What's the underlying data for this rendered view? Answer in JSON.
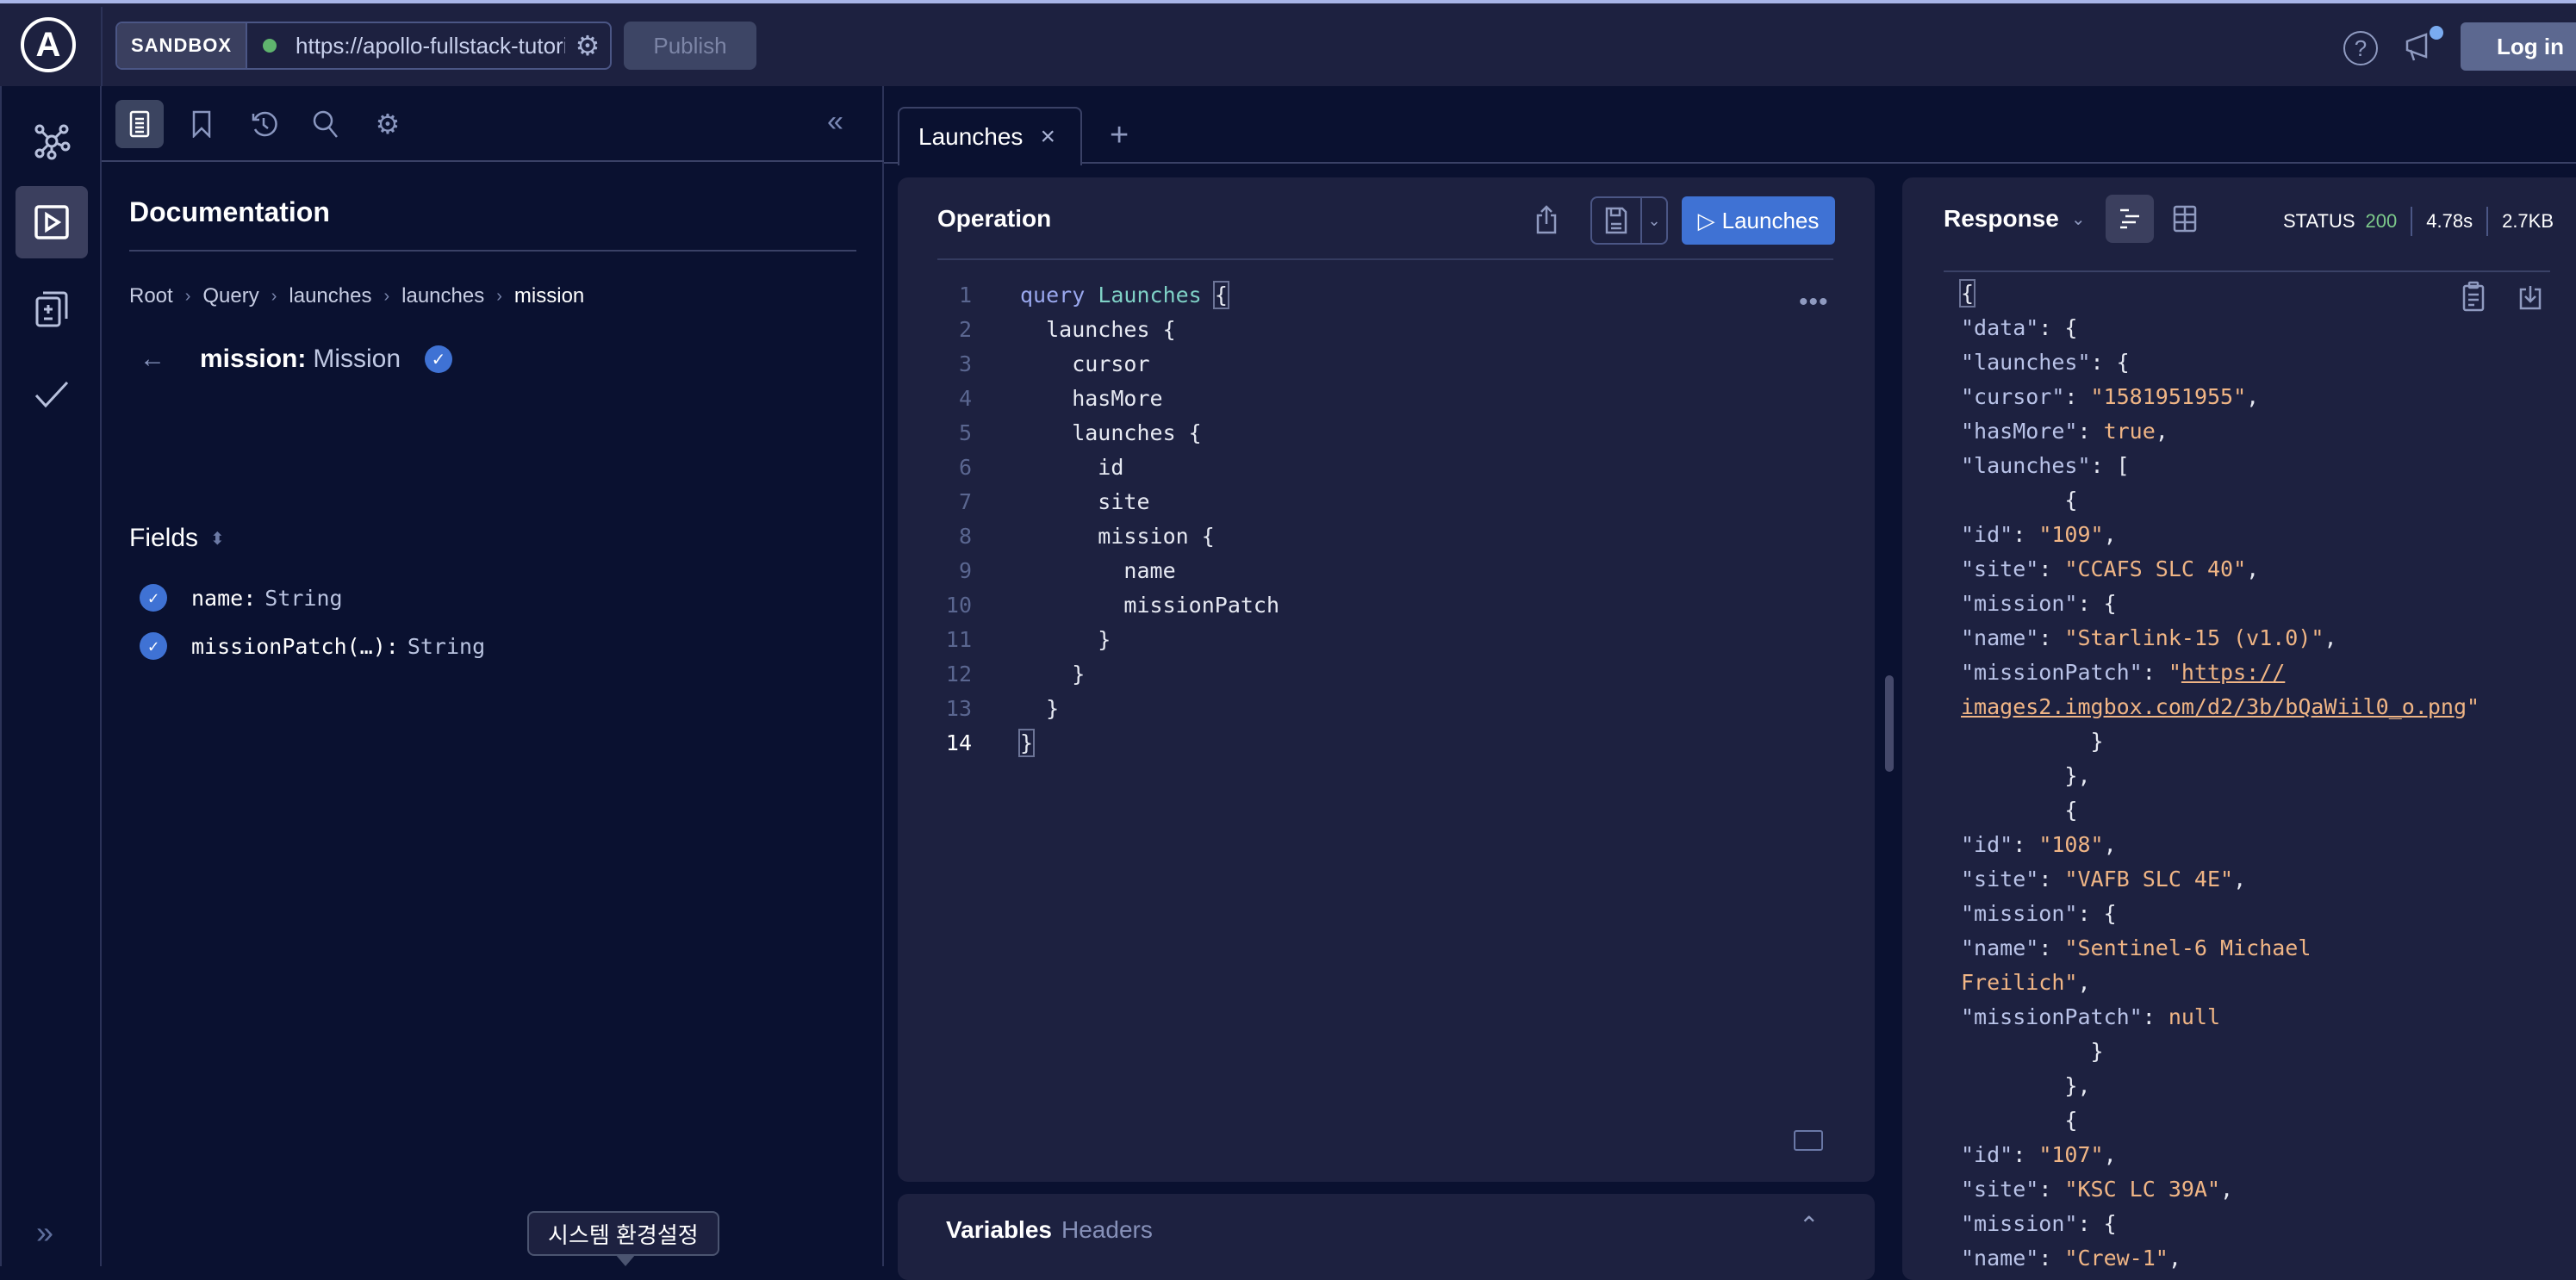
{
  "topbar": {
    "sandbox_label": "SANDBOX",
    "endpoint_url": "https://apollo-fullstack-tutorial",
    "connection_status_color": "#5fb46e",
    "publish_label": "Publish",
    "login_label": "Log in",
    "help_icon": "question-circle-icon",
    "announcement_icon": "megaphone-icon"
  },
  "leftnav": {
    "items": [
      {
        "name": "schema",
        "icon": "graph-icon"
      },
      {
        "name": "explorer",
        "icon": "play-square-icon",
        "active": true
      },
      {
        "name": "diff",
        "icon": "files-diff-icon"
      },
      {
        "name": "checks",
        "icon": "check-icon"
      }
    ],
    "expand_label": "»"
  },
  "docs": {
    "toolbar": [
      "documentation-icon",
      "bookmark-icon",
      "history-icon",
      "search-icon",
      "settings-icon"
    ],
    "collapse_label": "«",
    "title": "Documentation",
    "breadcrumb": [
      "Root",
      "Query",
      "launches",
      "launches",
      "mission"
    ],
    "type_field": "mission:",
    "type_name": "Mission",
    "fields_label": "Fields",
    "fields": [
      {
        "name": "name:",
        "type": "String",
        "checked": true
      },
      {
        "name": "missionPatch(…):",
        "type": "String",
        "checked": true
      }
    ]
  },
  "tooltip": "시스템 환경설정",
  "tabs": [
    {
      "label": "Launches",
      "close": "×"
    }
  ],
  "tab_add": "+",
  "operation": {
    "title": "Operation",
    "run_label": "Launches",
    "more": "•••",
    "lines": [
      "query Launches {",
      "  launches {",
      "    cursor",
      "    hasMore",
      "    launches {",
      "      id",
      "      site",
      "      mission {",
      "        name",
      "        missionPatch",
      "      }",
      "    }",
      "  }",
      "}"
    ],
    "current_line": 14
  },
  "variables": {
    "tab_variables": "Variables",
    "tab_headers": "Headers"
  },
  "response": {
    "title": "Response",
    "status_label": "STATUS",
    "status_code": "200",
    "time": "4.78s",
    "size": "2.7KB",
    "lines": [
      "{",
      "  \"data\": {",
      "    \"launches\": {",
      "      \"cursor\": \"1581951955\",",
      "      \"hasMore\": true,",
      "      \"launches\": [",
      "        {",
      "          \"id\": \"109\",",
      "          \"site\": \"CCAFS SLC 40\",",
      "          \"mission\": {",
      "            \"name\": \"Starlink-15 (v1.0)\",",
      "            \"missionPatch\": \"https://",
      "images2.imgbox.com/d2/3b/bQaWiil0_o.png\"",
      "          }",
      "        },",
      "        {",
      "          \"id\": \"108\",",
      "          \"site\": \"VAFB SLC 4E\",",
      "          \"mission\": {",
      "            \"name\": \"Sentinel-6 Michael",
      "Freilich\",",
      "            \"missionPatch\": null",
      "          }",
      "        },",
      "        {",
      "          \"id\": \"107\",",
      "          \"site\": \"KSC LC 39A\",",
      "          \"mission\": {",
      "            \"name\": \"Crew-1\","
    ]
  }
}
